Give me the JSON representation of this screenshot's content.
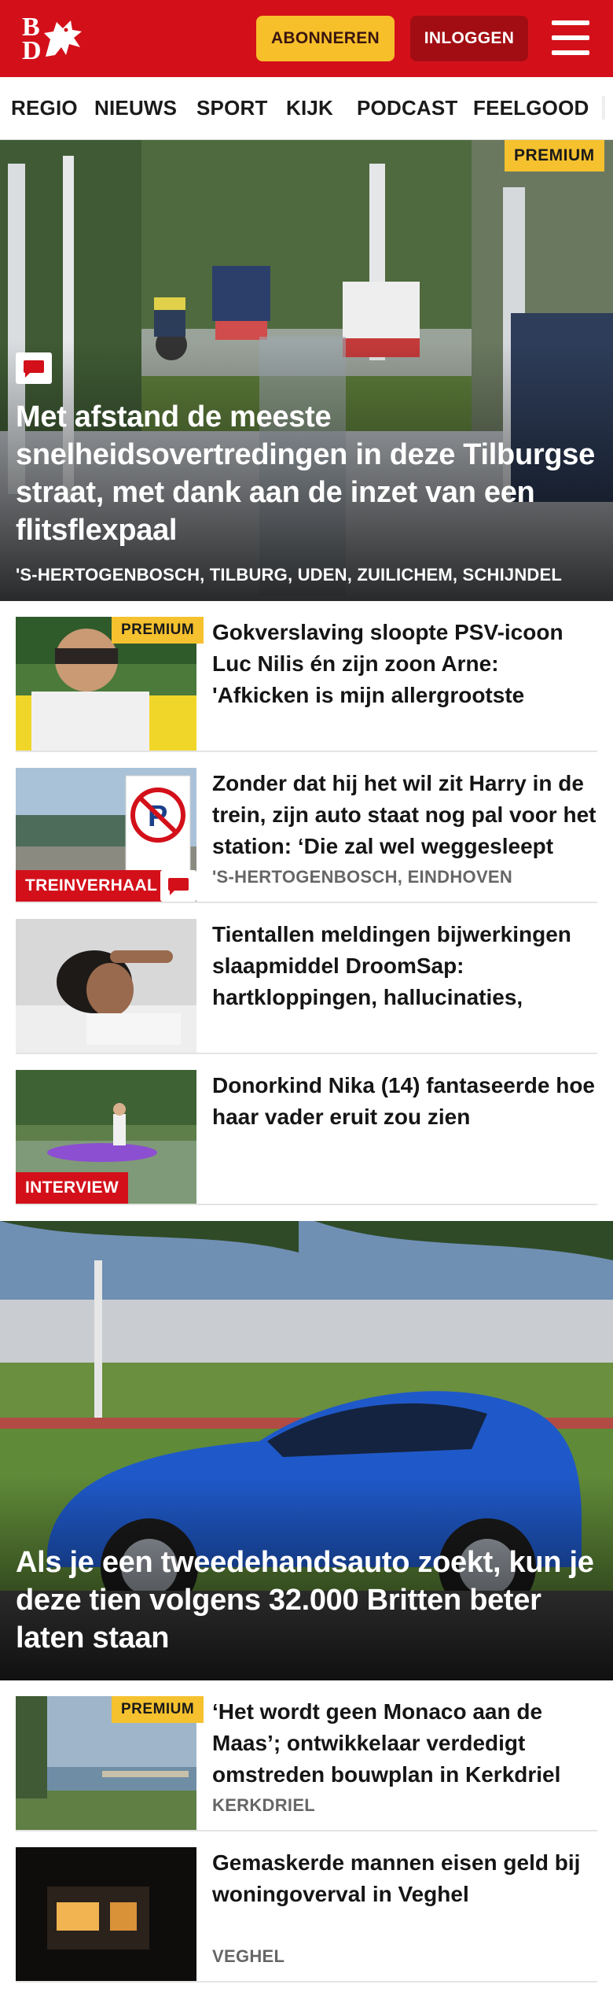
{
  "header": {
    "logo_text_top": "B",
    "logo_text_bottom": "D",
    "subscribe_label": "ABONNEREN",
    "login_label": "INLOGGEN",
    "menu_icon": "hamburger-menu-icon",
    "brand_color": "#d3101a",
    "subscribe_color": "#f7bf2a"
  },
  "nav": {
    "items": [
      "REGIO",
      "NIEUWS",
      "SPORT",
      "KIJK",
      "PODCAST",
      "FEELGOOD"
    ]
  },
  "hero": {
    "badge": "PREMIUM",
    "comment_icon": "comment-icon",
    "title": "Met afstand de meeste snelheidsovertredingen in deze Tilburgse straat, met dank aan de inzet van een flitsflexpaal",
    "locations": "'S-HERTOGENBOSCH, TILBURG, UDEN, ZUILICHEM, SCHIJNDEL"
  },
  "articles": [
    {
      "badge": "PREMIUM",
      "title": "Gokverslaving sloopte PSV-icoon Luc Nilis én zijn zoon Arne: 'Afkicken is mijn allergrootste overwinning'",
      "label": "",
      "meta": ""
    },
    {
      "badge": "",
      "title": "Zonder dat hij het wil zit Harry in de trein, zijn auto staat nog pal voor het station: ‘Die zal wel weggesleept zijn’",
      "label": "TREINVERHAAL",
      "meta": "'S-HERTOGENBOSCH, EINDHOVEN"
    },
    {
      "badge": "",
      "title": "Tientallen meldingen bijwerkingen slaapmiddel DroomSap: hartkloppingen, hallucinaties, nachtmerries",
      "label": "",
      "meta": ""
    },
    {
      "badge": "",
      "title": "Donorkind Nika (14) fantaseerde hoe haar vader eruit zou zien",
      "label": "INTERVIEW",
      "meta": ""
    }
  ],
  "feature": {
    "title": "Als je een tweedehandsauto zoekt, kun je deze tien volgens 32.000 Britten beter laten staan"
  },
  "articles2": [
    {
      "badge": "PREMIUM",
      "title": "‘Het wordt geen Monaco aan de Maas’; ontwikkelaar verdedigt omstreden bouwplan in Kerkdriel",
      "meta": "KERKDRIEL"
    },
    {
      "badge": "",
      "title": "Gemaskerde mannen eisen geld bij woningoverval in Veghel",
      "meta": "VEGHEL"
    }
  ]
}
